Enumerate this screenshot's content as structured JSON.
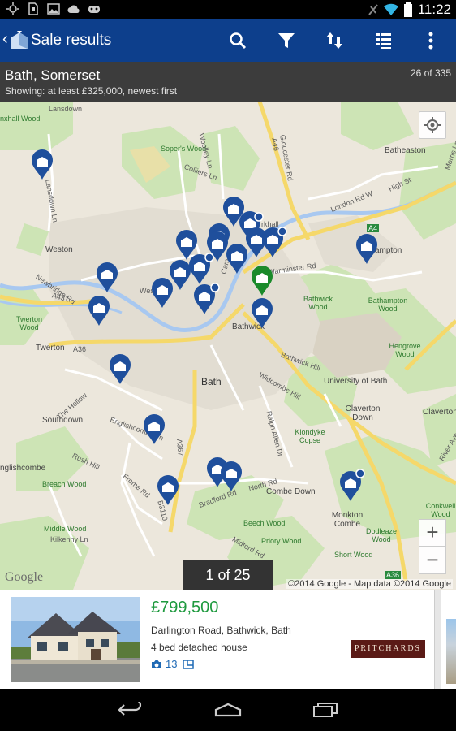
{
  "status_bar": {
    "time": "11:22"
  },
  "action_bar": {
    "title": "Sale results"
  },
  "summary": {
    "location": "Bath, Somerset",
    "description": "Showing: at least £325,000, newest first",
    "count": "26 of 335"
  },
  "map": {
    "labels": {
      "lansdown": "Lansdown",
      "kill_wood": "nxhall Wood",
      "lansdown_ln": "Lansdown Ln",
      "sopers_wood": "Soper's Wood",
      "colliers_ln": "Colliers Ln",
      "woolley_ln": "Woolley Ln",
      "gloucester_rd": "Gloucester Rd",
      "a46": "A46",
      "batheaston": "Batheaston",
      "london_rd": "London Rd W",
      "high_st": "High St",
      "morris_ln": "Morris Ln",
      "a4": "A4",
      "weston": "Weston",
      "ampton": "ampton",
      "warminster_rd": "Warminster Rd",
      "a431": "A431",
      "newbridge_rd": "Newbridge Rd",
      "twerton_wood": "Twerton Wood",
      "bathwick_wood": "Bathwick Wood",
      "bathampton_wood": "Bathampton Wood",
      "bathwick": "Bathwick",
      "a36": "A36",
      "twerton": "Twerton",
      "bathwick_hill": "Bathwick Hill",
      "hengrove_wood": "Hengrove Wood",
      "bath": "Bath",
      "university": "University of Bath",
      "the_hollow": "The Hollow",
      "widcombe_hill": "Widcombe Hill",
      "southdown": "Southdown",
      "englishcombe_ln": "Englishcombe Ln",
      "claverton_down": "Claverton Down",
      "claverton": "Claverton",
      "ralph_allen": "Ralph Allen Dr",
      "klondyke": "Klondyke Copse",
      "englishcombe": "nglishcombe",
      "rush_hill": "Rush Hill",
      "a367": "A367",
      "breach_wood": "Breach Wood",
      "combe_down": "Combe Down",
      "north_rd": "North Rd",
      "bradford_rd": "Bradford Rd",
      "frome_rd": "Frome Rd",
      "conkwell_wood": "Conkwell Wood",
      "monkton_combe": "Monkton Combe",
      "middle_wood": "Middle Wood",
      "kilkenny_ln": "Kilkenny Ln",
      "beech_wood": "Beech Wood",
      "midford_rd": "Midford Rd",
      "priory_wood": "Priory Wood",
      "dodleaze_wood": "Dodleaze Wood",
      "short_wood": "Short Wood",
      "a36b": "A36",
      "b3110": "B3110",
      "cam": "Cam",
      "wes": "Wes",
      "rkhall": "rkhall",
      "river_ave": "River Ave"
    },
    "google_logo": "Google",
    "attribution": "©2014 Google - Map data ©2014 Google",
    "zoom_in": "+",
    "zoom_out": "−",
    "pager": "1 of 25"
  },
  "listing": {
    "price": "£799,500",
    "address": "Darlington Road, Bathwick, Bath",
    "type": "4 bed detached house",
    "photos": "13",
    "agent": "PRITCHARDS"
  },
  "colors": {
    "action_bar": "#0d3f8c",
    "pin_blue": "#1f4f9c",
    "pin_selected": "#1a8a2a",
    "price_green": "#1f9a3f"
  },
  "icons": [
    "search-icon",
    "filter-icon",
    "sort-icon",
    "list-view-icon",
    "overflow-menu-icon",
    "my-location-icon",
    "camera-icon",
    "floorplan-icon",
    "back-icon",
    "home-icon",
    "recents-icon"
  ]
}
